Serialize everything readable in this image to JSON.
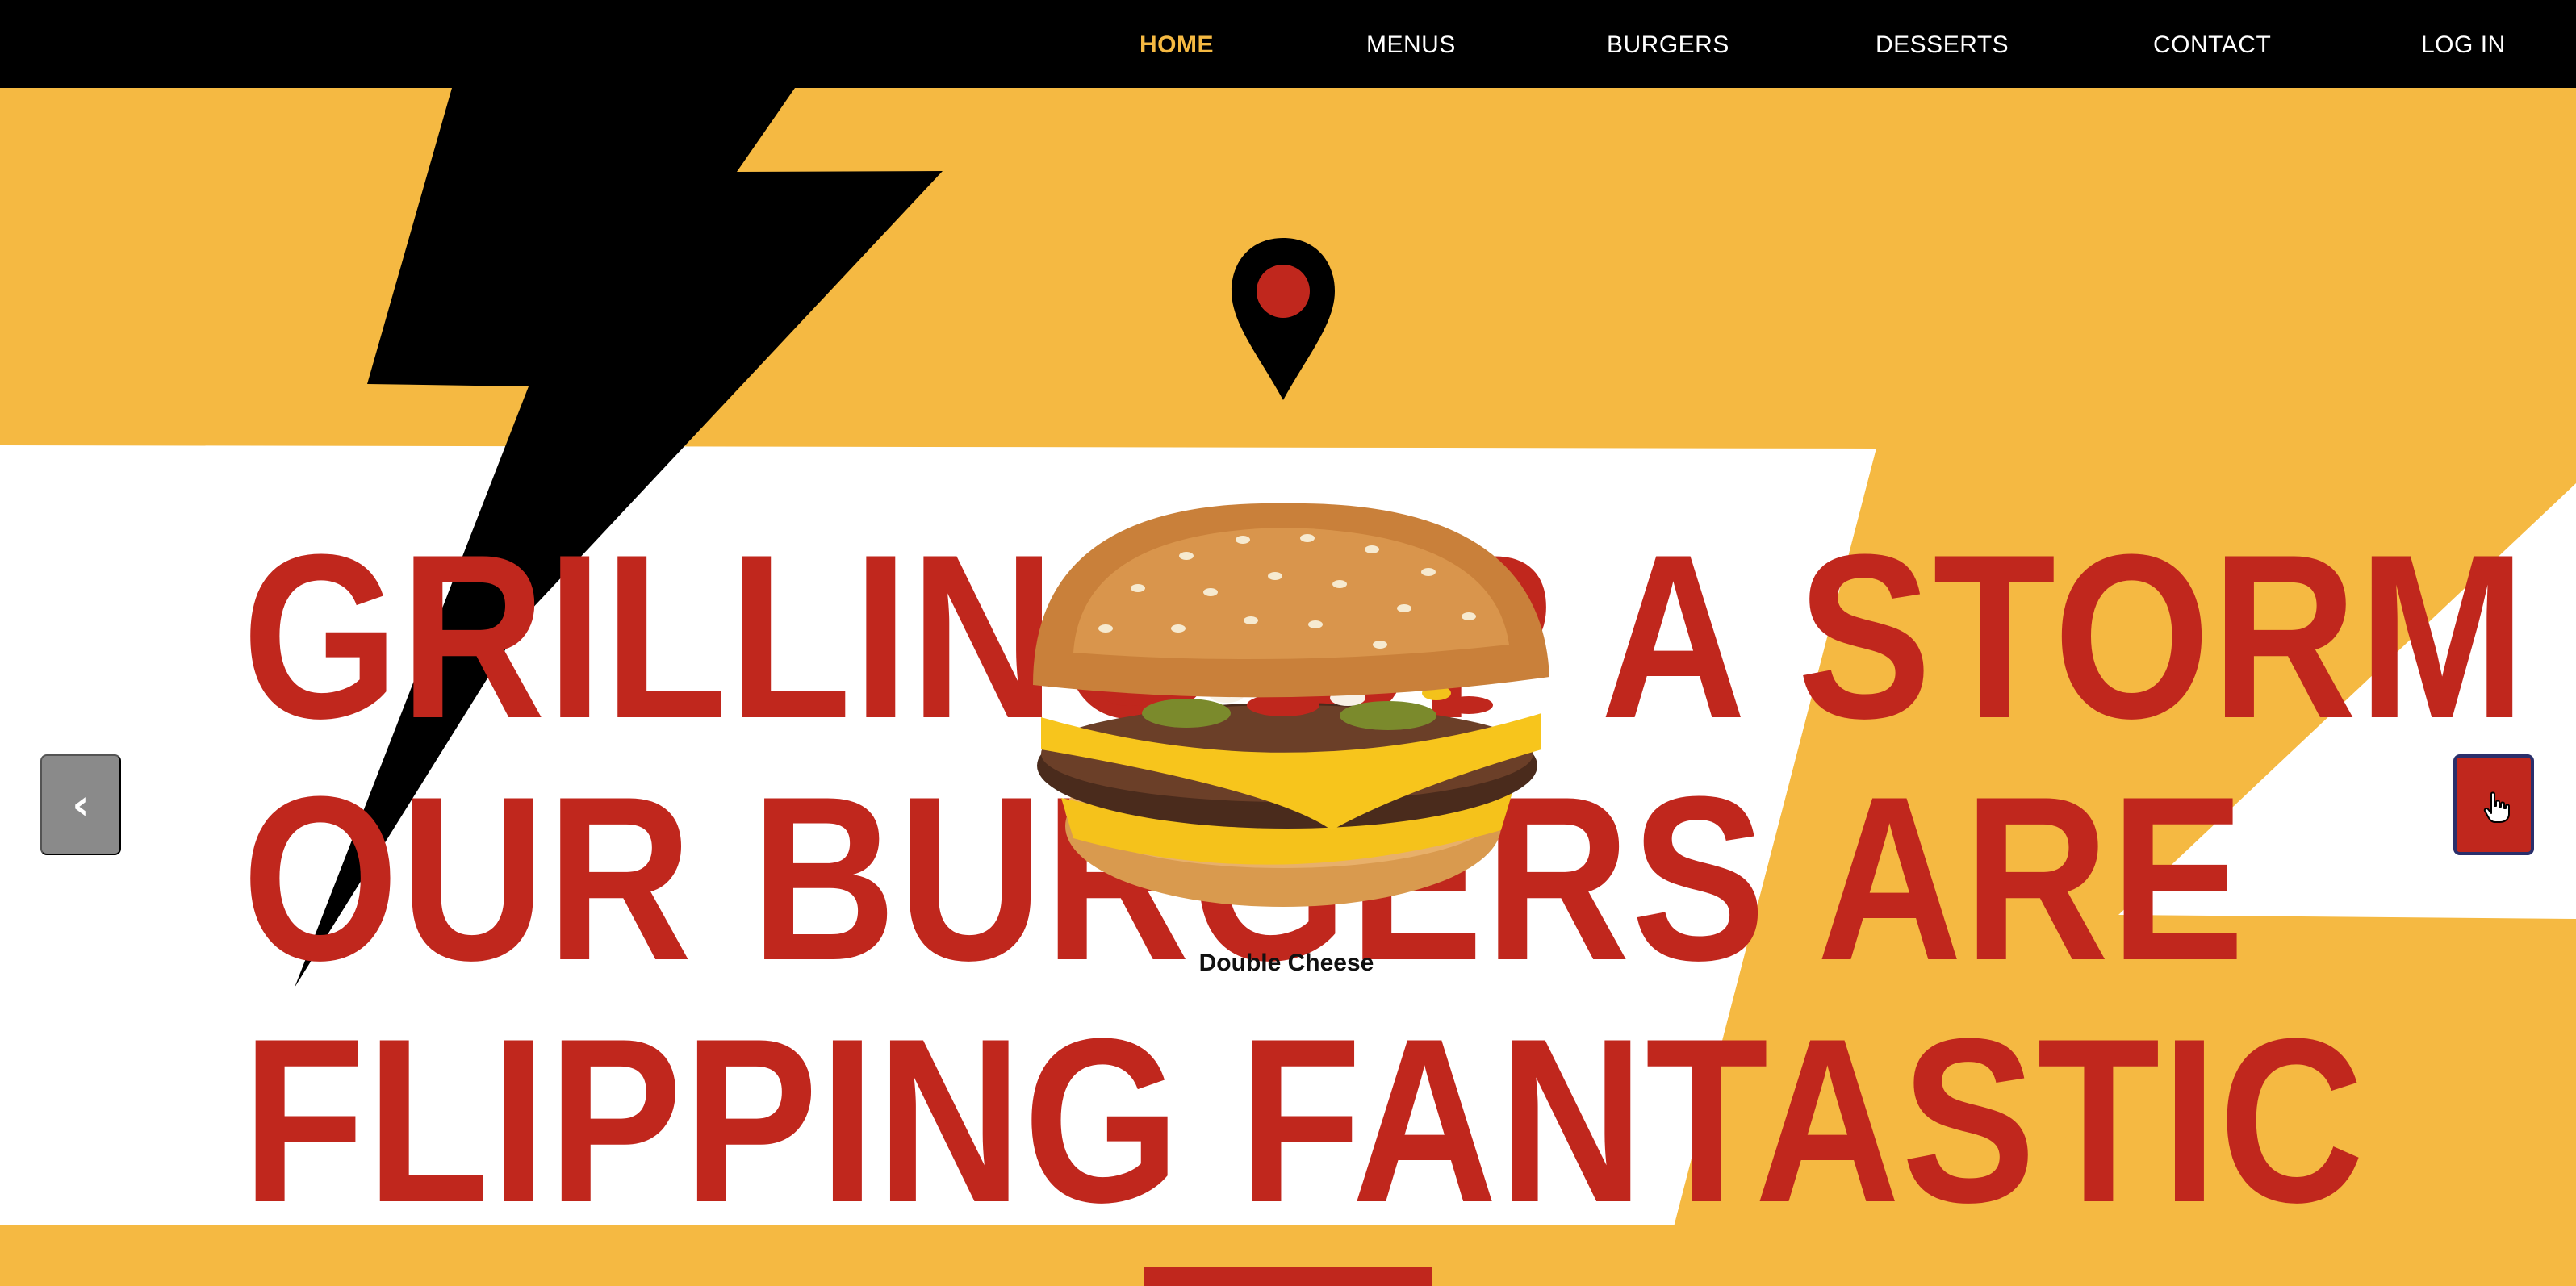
{
  "nav": {
    "items": [
      {
        "label": "HOME",
        "active": true
      },
      {
        "label": "MENUS",
        "active": false
      },
      {
        "label": "BURGERS",
        "active": false
      },
      {
        "label": "DESSERTS",
        "active": false
      },
      {
        "label": "CONTACT",
        "active": false
      },
      {
        "label": "LOG IN",
        "active": false
      }
    ]
  },
  "hero": {
    "headline_lines": [
      "GRILLING UP A STORM",
      "OUR BURGERS ARE",
      "FLIPPING FANTASTIC"
    ],
    "featured_item": {
      "name": "Double Cheese",
      "image_icon": "cheeseburger-image"
    },
    "location_icon": "map-pin-icon",
    "carousel": {
      "prev_glyph": "‹",
      "prev_icon": "chevron-left-icon",
      "next_icon": "chevron-right-icon"
    }
  },
  "colors": {
    "brand_red": "#c0271d",
    "brand_yellow": "#f5b942",
    "nav_background": "#000000",
    "active_nav": "#f5b942",
    "prev_button": "#8a8a8a"
  }
}
